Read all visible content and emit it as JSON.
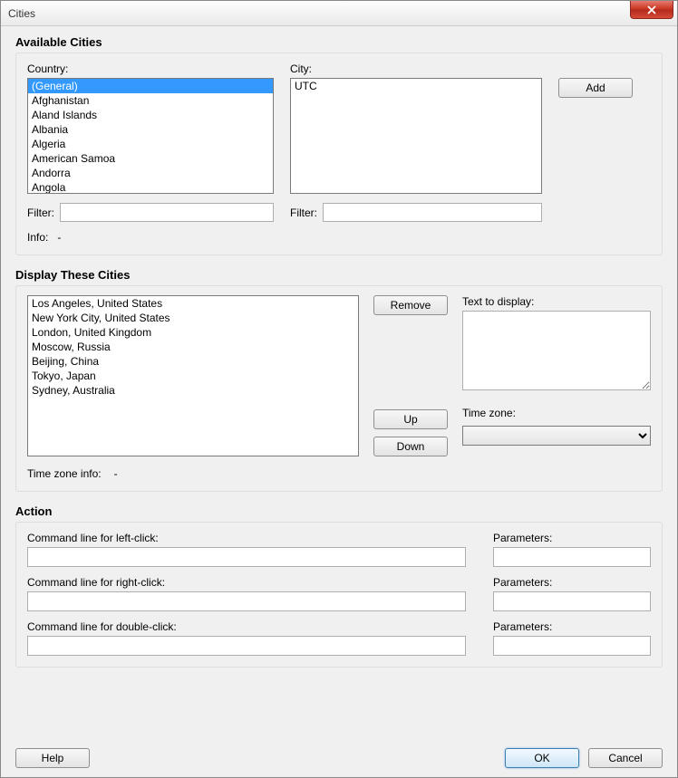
{
  "window": {
    "title": "Cities"
  },
  "available": {
    "group_title": "Available Cities",
    "country_label": "Country:",
    "city_label": "City:",
    "add_label": "Add",
    "countries": [
      "(General)",
      "Afghanistan",
      "Aland Islands",
      "Albania",
      "Algeria",
      "American Samoa",
      "Andorra",
      "Angola"
    ],
    "selected_country_index": 0,
    "cities": [
      "UTC"
    ],
    "filter_label": "Filter:",
    "filter_country": "",
    "filter_city": "",
    "info_label": "Info:",
    "info_value": "-"
  },
  "display": {
    "group_title": "Display These Cities",
    "items": [
      "Los Angeles, United States",
      "New York City, United States",
      "London, United Kingdom",
      "Moscow, Russia",
      "Beijing, China",
      "Tokyo, Japan",
      "Sydney, Australia"
    ],
    "remove_label": "Remove",
    "up_label": "Up",
    "down_label": "Down",
    "text_to_display_label": "Text to display:",
    "text_to_display_value": "",
    "timezone_label": "Time zone:",
    "timezone_value": "",
    "tz_info_label": "Time zone info:",
    "tz_info_value": "-"
  },
  "action": {
    "group_title": "Action",
    "left_click_label": "Command line for left-click:",
    "left_click_value": "",
    "left_click_params": "",
    "right_click_label": "Command line for right-click:",
    "right_click_value": "",
    "right_click_params": "",
    "double_click_label": "Command line for double-click:",
    "double_click_value": "",
    "double_click_params": "",
    "parameters_label": "Parameters:"
  },
  "footer": {
    "help_label": "Help",
    "ok_label": "OK",
    "cancel_label": "Cancel"
  }
}
